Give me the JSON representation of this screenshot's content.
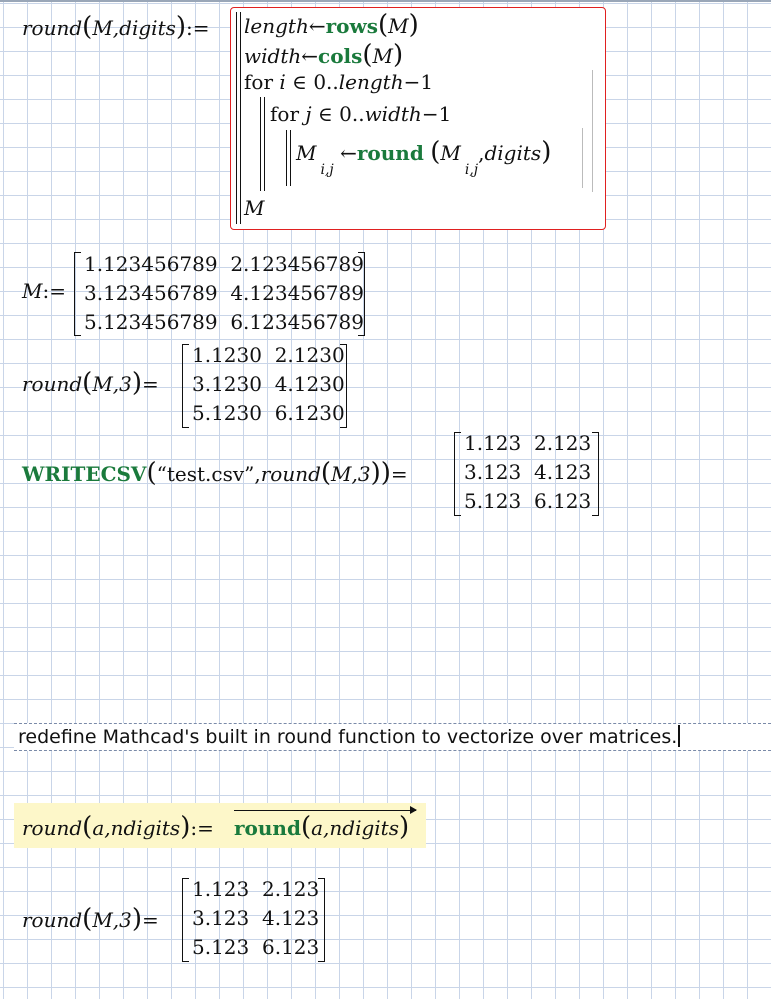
{
  "program": {
    "def_name": "round",
    "def_params": "M,digits",
    "assign": ":=",
    "line1_var": "length",
    "line1_fn": "rows",
    "line1_arg": "M",
    "line2_var": "width",
    "line2_fn": "cols",
    "line2_arg": "M",
    "for_i": "for",
    "var_i": "i",
    "elem": "∈",
    "range_i_start": "0",
    "range_dots": "..",
    "range_i_end": "length",
    "minus_one": "−1",
    "for_j": "for",
    "var_j": "j",
    "range_j_end": "width",
    "body_M": "M",
    "body_sub": "i,j",
    "arrow": "←",
    "body_fn": "round",
    "body_digits": "digits",
    "return_M": "M"
  },
  "matrix_def": {
    "name": "M",
    "assign": ":=",
    "rows": [
      [
        "1.123456789",
        "2.123456789"
      ],
      [
        "3.123456789",
        "4.123456789"
      ],
      [
        "5.123456789",
        "6.123456789"
      ]
    ]
  },
  "eval1": {
    "fn": "round",
    "args": "M,3",
    "eq": "=",
    "rows": [
      [
        "1.1230",
        "2.1230"
      ],
      [
        "3.1230",
        "4.1230"
      ],
      [
        "5.1230",
        "6.1230"
      ]
    ]
  },
  "eval2": {
    "fn": "WRITECSV",
    "file": "“test.csv”",
    "inner_fn": "round",
    "inner_args": "M,3",
    "eq": "=",
    "rows": [
      [
        "1.123",
        "2.123"
      ],
      [
        "3.123",
        "4.123"
      ],
      [
        "5.123",
        "6.123"
      ]
    ]
  },
  "note": {
    "text": "redefine Mathcad's built in round function to vectorize over matrices."
  },
  "redefine": {
    "name": "round",
    "params": "a,ndigits",
    "assign": ":=",
    "fn": "round",
    "args": "a,ndigits"
  },
  "eval3": {
    "fn": "round",
    "args": "M,3",
    "eq": "=",
    "rows": [
      [
        "1.123",
        "2.123"
      ],
      [
        "3.123",
        "4.123"
      ],
      [
        "5.123",
        "6.123"
      ]
    ]
  }
}
